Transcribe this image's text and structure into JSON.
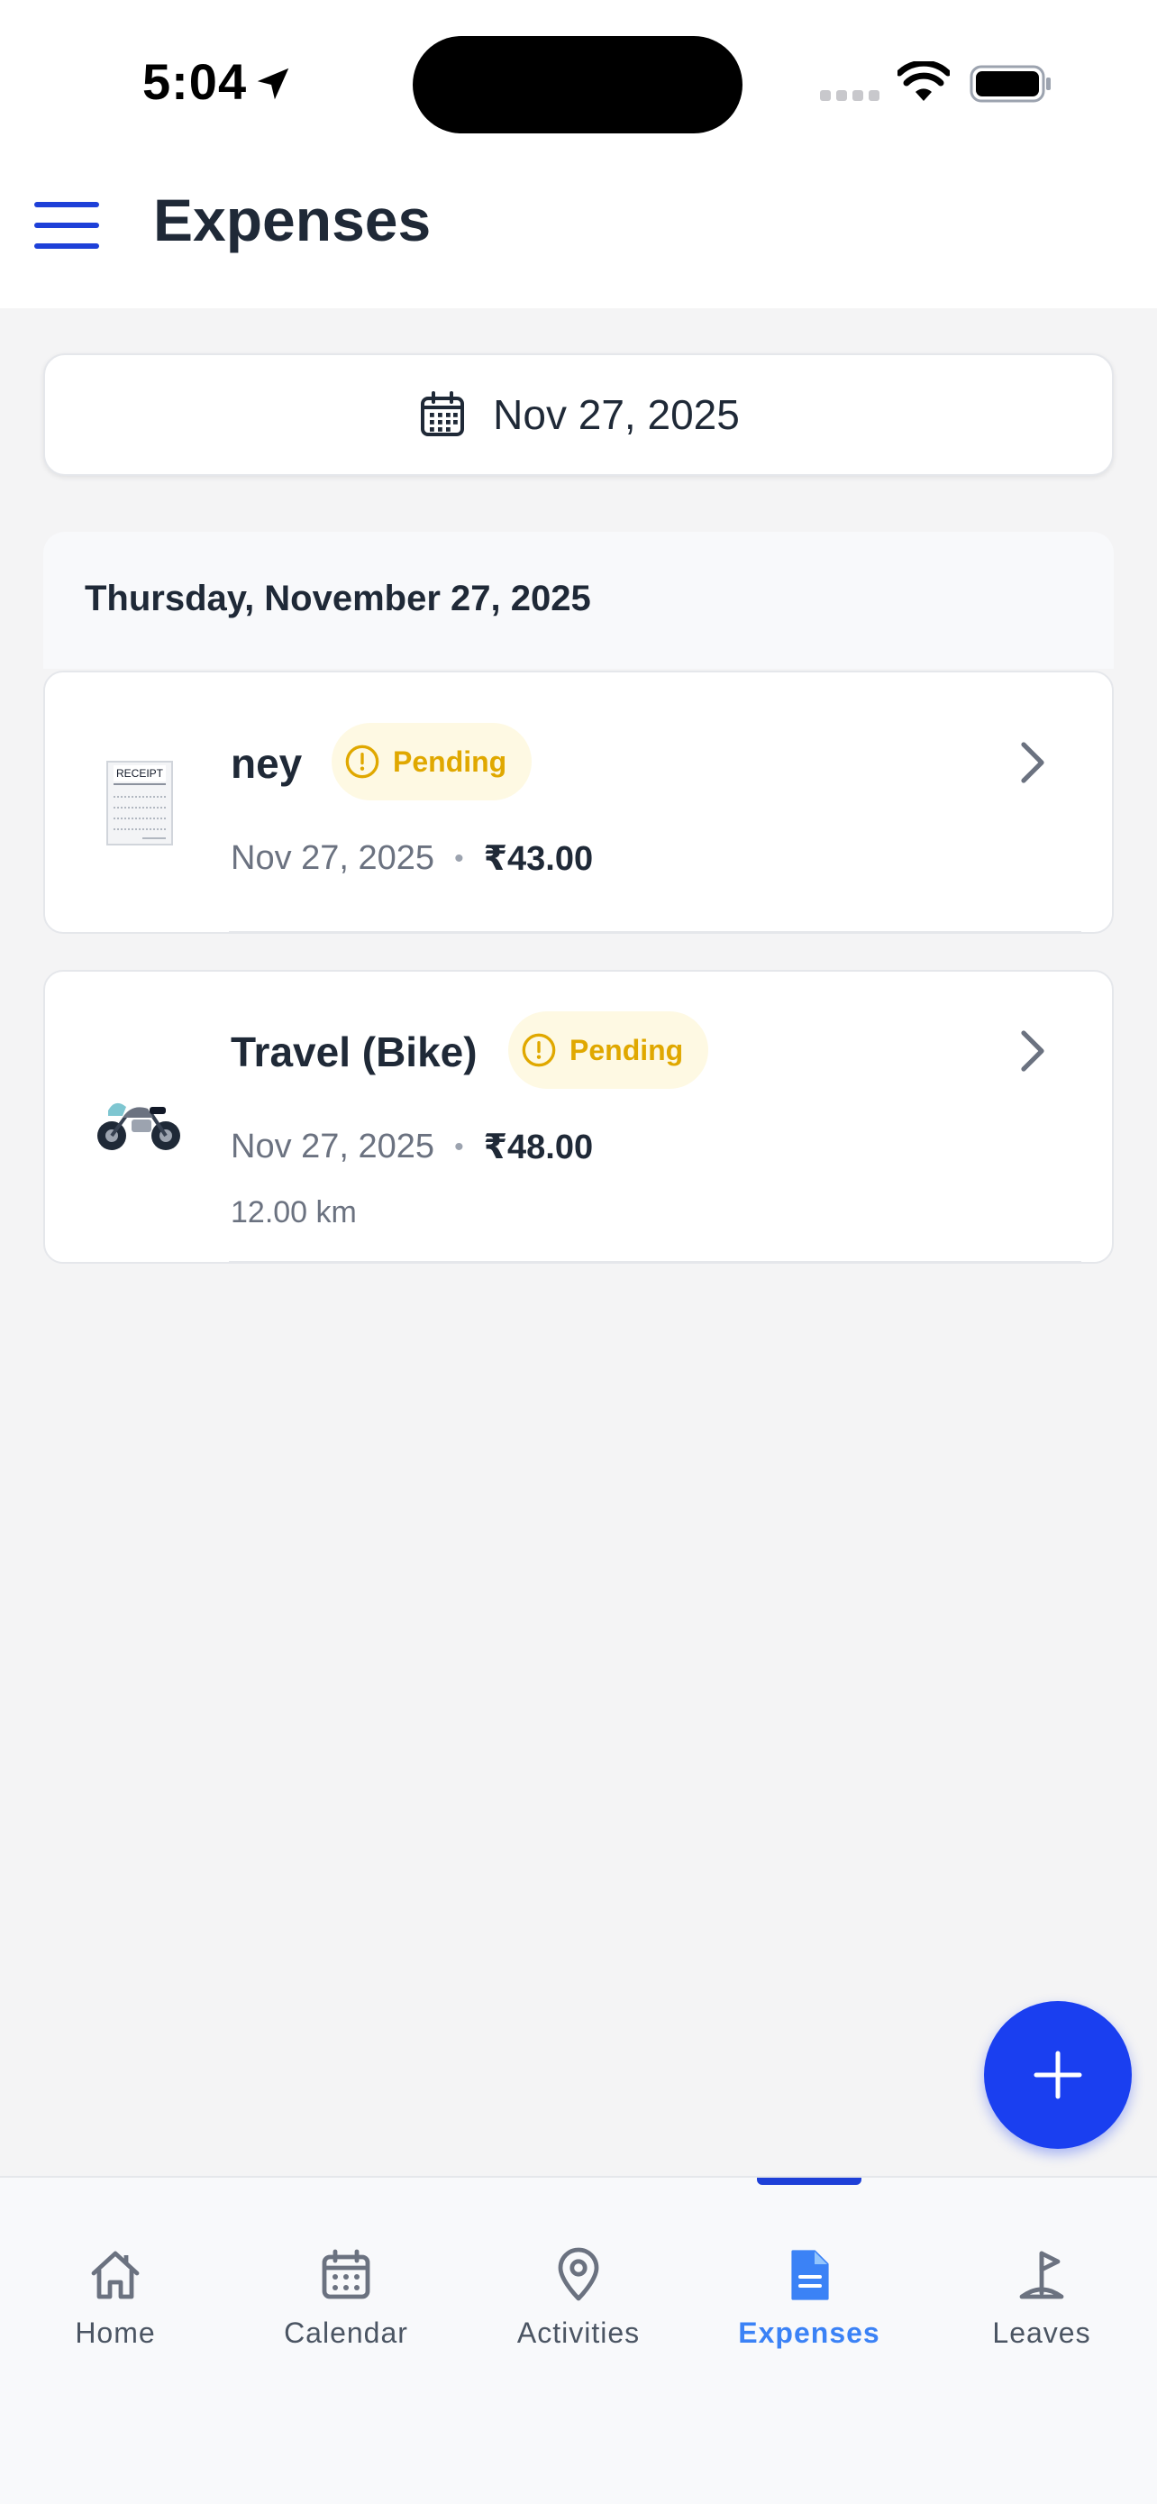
{
  "status_bar": {
    "time": "5:04"
  },
  "header": {
    "title": "Expenses"
  },
  "date_picker": {
    "date": "Nov 27, 2025"
  },
  "day_group": {
    "label": "Thursday, November 27, 2025",
    "items": [
      {
        "title": "ney",
        "status": "Pending",
        "date": "Nov 27, 2025",
        "amount": "₹43.00",
        "icon": "receipt-icon",
        "receipt_heading": "RECEIPT"
      },
      {
        "title": "Travel (Bike)",
        "status": "Pending",
        "date": "Nov 27, 2025",
        "amount": "₹48.00",
        "distance": "12.00 km",
        "icon": "motorbike-icon"
      }
    ]
  },
  "nav": {
    "items": [
      {
        "label": "Home",
        "icon": "home-icon"
      },
      {
        "label": "Calendar",
        "icon": "calendar-icon"
      },
      {
        "label": "Activities",
        "icon": "map-pin-icon"
      },
      {
        "label": "Expenses",
        "icon": "document-icon",
        "active": true
      },
      {
        "label": "Leaves",
        "icon": "flag-icon"
      }
    ]
  },
  "colors": {
    "accent": "#1e40d8",
    "fab": "#1a3ff0",
    "pending_text": "#e0a800",
    "pending_bg": "#fef9e3",
    "active_nav": "#3b82f6"
  }
}
